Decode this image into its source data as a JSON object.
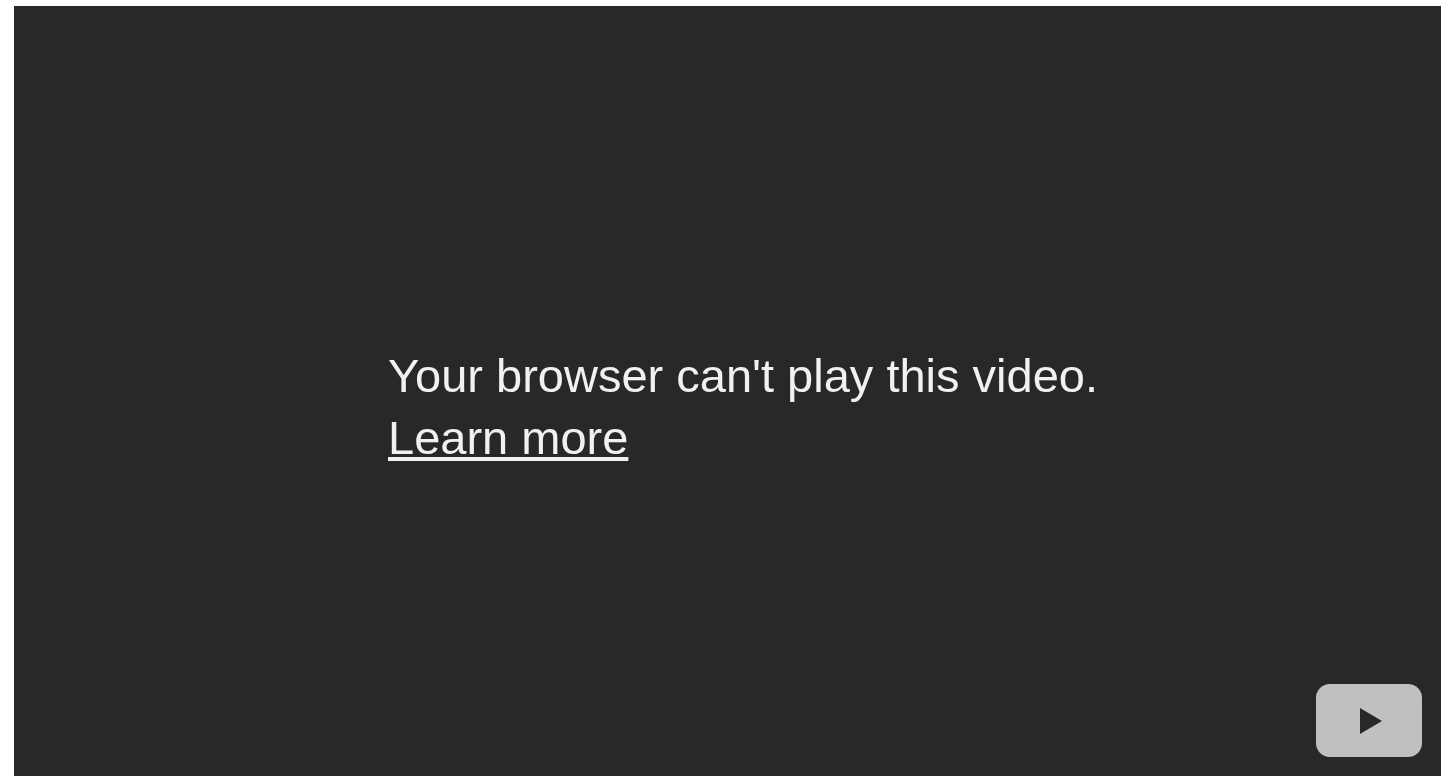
{
  "player": {
    "message": "Your browser can't play this video.",
    "link": "Learn more"
  }
}
